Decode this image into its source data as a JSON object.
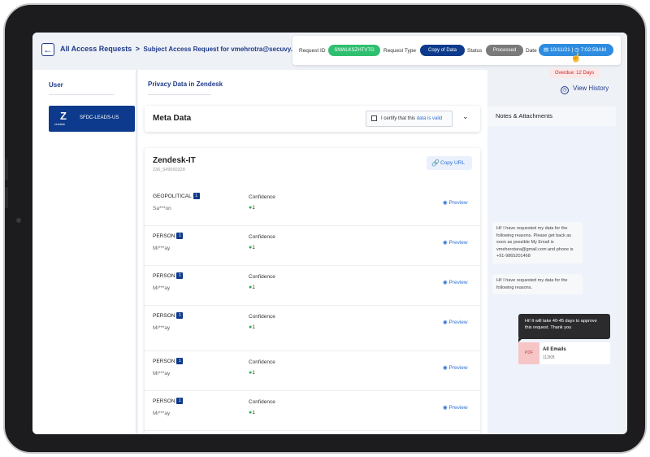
{
  "header": {
    "breadcrumb_main": "All Access Requests",
    "breadcrumb_sep": ">",
    "breadcrumb_sub": "Subject Access Request for vmehrotra@secuvy.com"
  },
  "request": {
    "id_label": "Request ID",
    "id_value": "SNWLKSZHTVTG",
    "type_label": "Request Type",
    "type_value": "Copy of Data",
    "status_label": "Status",
    "status_value": "Processed",
    "date_label": "Date",
    "date_value": "10/11/21",
    "time_value": "7:02:59AM",
    "overdue": "Overdue: 12 Days",
    "colors": {
      "id": "#2fbf71",
      "type": "#0d3a8c",
      "status": "#7a7a7a",
      "date": "#2d8ce0"
    }
  },
  "left": {
    "user_label": "User",
    "source_name": "SFDC-LEADS-US",
    "source_logo_text": "zendesk"
  },
  "main": {
    "tab_label": "Privacy Data in Zendesk",
    "meta_title": "Meta Data",
    "certify_text": "I certify that this",
    "certify_highlight": "data is valid",
    "card_title": "Zendesk-IT",
    "card_id": "236_549650328",
    "copy_url": "Copy URL",
    "confidence_label": "Confidence",
    "preview_label": "Preview",
    "rows": [
      {
        "entity": "GEOPOLITICAL",
        "badge": "1",
        "masked": "Sa***on",
        "confidence": "1"
      },
      {
        "entity": "PERSON",
        "badge": "1",
        "masked": "Mi***ay",
        "confidence": "1"
      },
      {
        "entity": "PERSON",
        "badge": "1",
        "masked": "Mi***ay",
        "confidence": "1"
      },
      {
        "entity": "PERSON",
        "badge": "1",
        "masked": "Mi***ay",
        "confidence": "1"
      },
      {
        "entity": "PERSON",
        "badge": "1",
        "masked": "Mi***ay",
        "confidence": "1"
      },
      {
        "entity": "PERSON",
        "badge": "1",
        "masked": "Mi***ay",
        "confidence": "1"
      }
    ]
  },
  "right": {
    "view_history": "View History",
    "notes_title": "Notes & Attachments",
    "message_1": "Hi! I have requested my data for the following reasons. Please get back as soon as possible My Email is vmeherotara@gmail.com and phone is +91-9865201468",
    "message_2": "Hi! I have requested my data for the following reasons.",
    "reply": "Hi! It will take 40-45 days to approve this request. Thank you",
    "attachment_type": "PDF",
    "attachment_name": "All Emails",
    "attachment_size": "112KB"
  }
}
